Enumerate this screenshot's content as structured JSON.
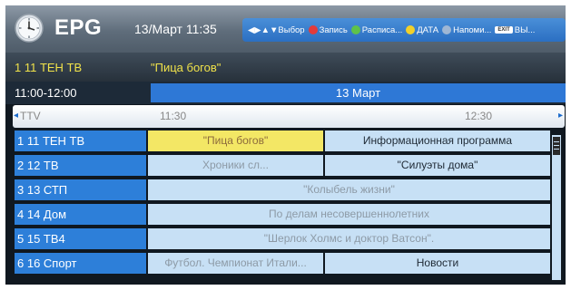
{
  "header": {
    "title": "EPG",
    "datetime": "13/Март 11:35",
    "legend": {
      "nav": "◀▶▲▼Выбор",
      "record": "Запись",
      "schedule": "Расписа...",
      "date": "ДАТА",
      "remind": "Напоми...",
      "exit_key": "EXIT",
      "exit": "ВЫ..."
    },
    "colors": {
      "record": "#e23b3b",
      "schedule": "#5fc24a",
      "date": "#f2d02a",
      "remind": "#9fb7d4"
    }
  },
  "info": {
    "channel": "1 11 ТЕН ТВ",
    "program": "\"Пица богов\""
  },
  "time_row": {
    "range": "11:00-12:00",
    "date": "13 Март"
  },
  "scale": {
    "group": "TTV",
    "t1": "11:30",
    "t2": "12:30"
  },
  "rows": [
    {
      "channel": "1 11 ТЕН ТВ",
      "programs": [
        "\"Пица богов\"",
        "Информационная программа"
      ]
    },
    {
      "channel": "2 12 ТВ",
      "programs": [
        "Хроники сл...",
        "\"Силуэты дома\""
      ]
    },
    {
      "channel": "3 13 СТП",
      "programs": [
        "\"Колыбель жизни\""
      ]
    },
    {
      "channel": "4 14 Дом",
      "programs": [
        "По делам несовершеннолетних"
      ]
    },
    {
      "channel": "5 15 ТВ4",
      "programs": [
        "\"Шерлок Холмс и доктор Ватсон\"."
      ]
    },
    {
      "channel": "6 16 Спорт",
      "programs": [
        "Футбол. Чемпионат Итали...",
        "Новости"
      ]
    }
  ]
}
